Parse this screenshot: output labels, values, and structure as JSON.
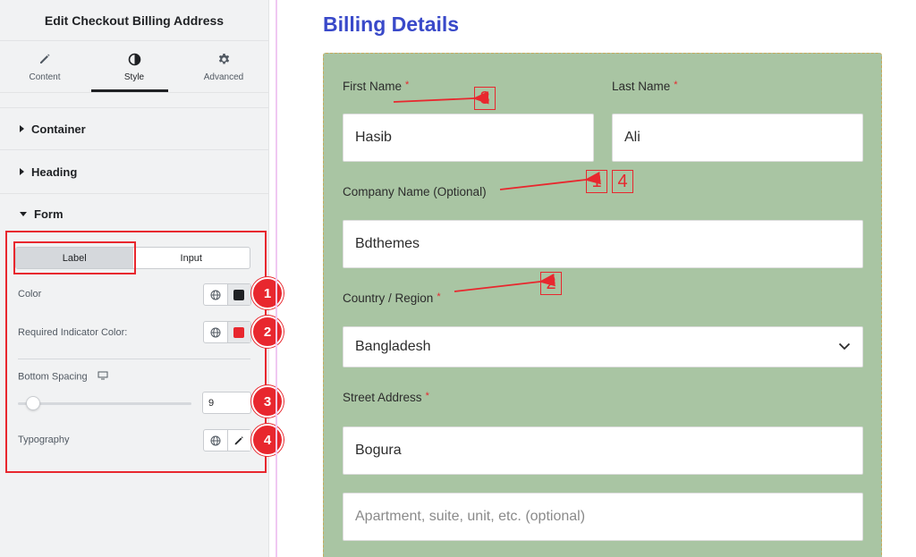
{
  "panel": {
    "title": "Edit Checkout Billing Address",
    "tabs": [
      {
        "label": "Content",
        "icon": "pencil-icon"
      },
      {
        "label": "Style",
        "icon": "half-circle-icon"
      },
      {
        "label": "Advanced",
        "icon": "gear-icon"
      }
    ],
    "active_tab": "Style",
    "sections": [
      "Container",
      "Heading",
      "Form"
    ],
    "form": {
      "toggle": {
        "label": "Label",
        "input": "Input",
        "selected": "Label"
      },
      "color_label": "Color",
      "color_value": "#1f2124",
      "required_label": "Required Indicator Color:",
      "required_value": "#e8272e",
      "spacing_label": "Bottom Spacing",
      "spacing_value": "9",
      "spacing_fraction": 0.1,
      "typography_label": "Typography"
    },
    "badges": [
      "1",
      "2",
      "3",
      "4"
    ]
  },
  "preview": {
    "title": "Billing Details",
    "first_name_label": "First Name",
    "first_name_value": "Hasib",
    "last_name_label": "Last Name",
    "last_name_value": "Ali",
    "company_label": "Company Name (Optional)",
    "company_value": "Bdthemes",
    "country_label": "Country / Region",
    "country_value": "Bangladesh",
    "street_label": "Street Address",
    "street_value": "Bogura",
    "apartment_placeholder": "Apartment, suite, unit, etc. (optional)",
    "required_mark": "*"
  },
  "annotations": {
    "marker_first_name": "3",
    "marker_company_a": "1",
    "marker_company_b": "4",
    "marker_country": "2"
  },
  "colors": {
    "accent_red": "#e8272e",
    "title_blue": "#3949c9",
    "form_bg": "#a9c5a3"
  }
}
